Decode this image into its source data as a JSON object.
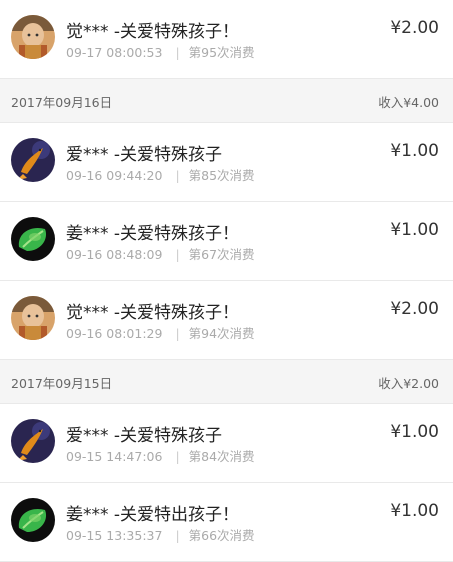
{
  "entries": [
    {
      "type": "row",
      "avatar": "monk-avatar",
      "name": "觉*** -关爱特殊孩子！",
      "time": "09-17 08:00:53",
      "count": "第95次消费",
      "amount": "¥2.00"
    },
    {
      "type": "header",
      "date": "2017年09月16日",
      "income": "收入¥4.00"
    },
    {
      "type": "row",
      "avatar": "koi-fish-avatar",
      "name": "爱*** -关爱特殊孩子",
      "time": "09-16 09:44:20",
      "count": "第85次消费",
      "amount": "¥1.00"
    },
    {
      "type": "row",
      "avatar": "green-leaf-avatar",
      "name": "姜*** -关爱特殊孩子！",
      "time": "09-16 08:48:09",
      "count": "第67次消费",
      "amount": "¥1.00"
    },
    {
      "type": "row",
      "avatar": "monk-avatar",
      "name": "觉*** -关爱特殊孩子！",
      "time": "09-16 08:01:29",
      "count": "第94次消费",
      "amount": "¥2.00"
    },
    {
      "type": "header",
      "date": "2017年09月15日",
      "income": "收入¥2.00"
    },
    {
      "type": "row",
      "avatar": "koi-fish-avatar",
      "name": "爱*** -关爱特殊孩子",
      "time": "09-15 14:47:06",
      "count": "第84次消费",
      "amount": "¥1.00"
    },
    {
      "type": "row",
      "avatar": "green-leaf-avatar",
      "name": "姜*** -关爱特出孩子！",
      "time": "09-15 13:35:37",
      "count": "第66次消费",
      "amount": "¥1.00"
    }
  ]
}
